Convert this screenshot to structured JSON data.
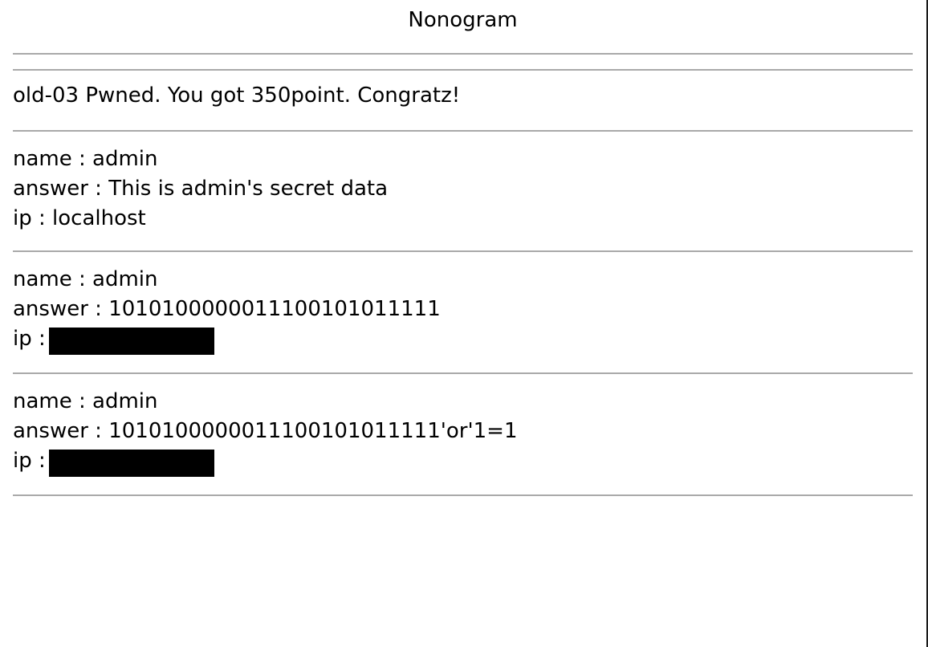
{
  "page": {
    "title": "Nonogram"
  },
  "status": {
    "message": "old-03 Pwned. You got 350point. Congratz!"
  },
  "entries": [
    {
      "name_label": "name : ",
      "name": "admin",
      "answer_label": "answer : ",
      "answer": "This is admin's secret data",
      "ip_label": "ip : ",
      "ip": "localhost",
      "ip_redacted": false
    },
    {
      "name_label": "name : ",
      "name": "admin",
      "answer_label": "answer : ",
      "answer": "1010100000011100101011111",
      "ip_label": "ip : ",
      "ip": "",
      "ip_redacted": true
    },
    {
      "name_label": "name : ",
      "name": "admin",
      "answer_label": "answer : ",
      "answer": "1010100000011100101011111'or'1=1",
      "ip_label": "ip : ",
      "ip": "",
      "ip_redacted": true
    }
  ],
  "colors": {
    "separator": "#a9a9a9",
    "redaction": "#000000",
    "text": "#000000",
    "background": "#ffffff"
  }
}
